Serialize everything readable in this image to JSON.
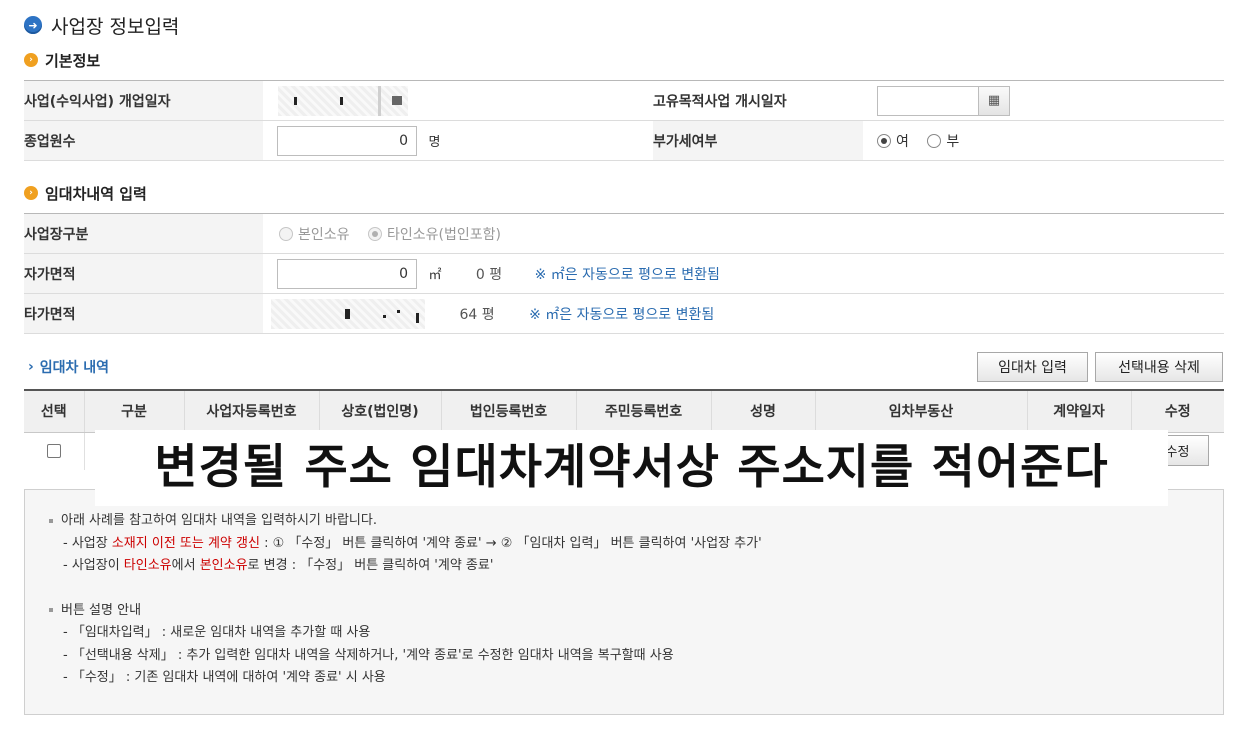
{
  "page": {
    "title": "사업장 정보입력",
    "title_icon": "arrow-right-circle-icon"
  },
  "basic": {
    "title": "기본정보",
    "open_date_label": "사업(수익사업) 개업일자",
    "purpose_date_label": "고유목적사업 개시일자",
    "purpose_date_value": "",
    "employees_label": "종업원수",
    "employees_value": "0",
    "employees_unit": "명",
    "vat_label": "부가세여부",
    "vat_yes": "여",
    "vat_no": "부",
    "vat_selected": "여"
  },
  "lease": {
    "title": "임대차내역 입력",
    "site_type_label": "사업장구분",
    "site_own": "본인소유",
    "site_other": "타인소유(법인포함)",
    "site_selected": "타인소유(법인포함)",
    "own_area_label": "자가면적",
    "own_area_value": "0",
    "area_unit": "㎡",
    "own_pyeong": "0 평",
    "convert_note": "※ ㎡은 자동으로 평으로 변환됨",
    "other_area_label": "타가면적",
    "other_pyeong": "64 평",
    "convert_note2": "※ ㎡은 자동으로 평으로 변환됨"
  },
  "lease_list": {
    "title": "임대차 내역",
    "add_button": "임대차 입력",
    "delete_button": "선택내용 삭제",
    "columns": [
      "선택",
      "구분",
      "사업자등록번호",
      "상호(법인명)",
      "법인등록번호",
      "주민등록번호",
      "성명",
      "임차부동산",
      "계약일자",
      "수정"
    ],
    "row_edit_button": "수정"
  },
  "overlay_text": "변경될 주소 임대차계약서상 주소지를 적어준다",
  "info": {
    "line1": "아래 사례를 참고하여 임대차 내역을 입력하시기 바랍니다.",
    "case1_prefix": "- 사업장 ",
    "case1_red": "소재지 이전 또는 계약 갱신",
    "case1_suffix": " : ① 「수정」 버튼 클릭하여 '계약 종료' → ② 「임대차 입력」 버튼 클릭하여 '사업장 추가'",
    "case2_prefix": "- 사업장이 ",
    "case2_red1": "타인소유",
    "case2_mid": "에서 ",
    "case2_red2": "본인소유",
    "case2_suffix": "로 변경 : 「수정」 버튼 클릭하여 '계약 종료'",
    "btn_title": "버튼 설명 안내",
    "btn1": "- 「임대차입력」 : 새로운 임대차 내역을 추가할 때 사용",
    "btn2": "- 「선택내용 삭제」 : 추가 입력한 임대차 내역을 삭제하거나, '계약 종료'로 수정한 임대차 내역을 복구할때 사용",
    "btn3": "- 「수정」 : 기존 임대차 내역에 대하여 '계약 종료' 시 사용"
  },
  "colors": {
    "accent_blue": "#2b6cb0",
    "icon_orange": "#f0a020",
    "warning_red": "#cc0000"
  }
}
